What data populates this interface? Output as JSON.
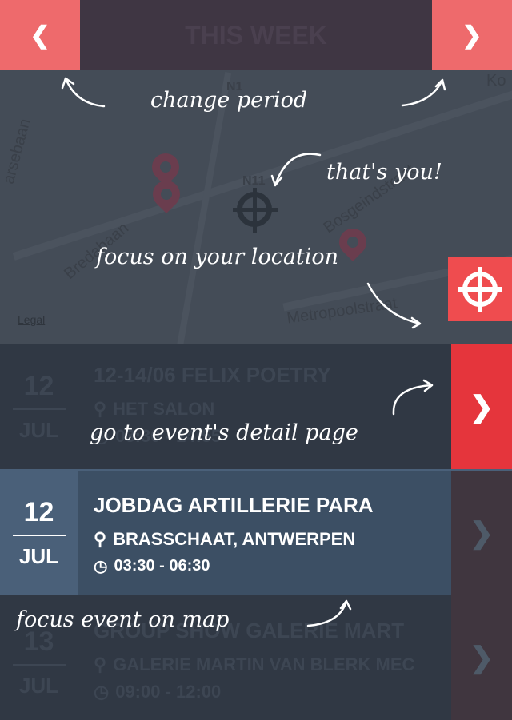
{
  "header": {
    "title": "THIS WEEK",
    "prev_icon": "chevron-left",
    "next_icon": "chevron-right"
  },
  "map": {
    "labels": [
      "N1",
      "N11",
      "Bredabaan",
      "Bosgeindstraat",
      "Metropoolstraat",
      "arsebaan",
      "Ko"
    ],
    "legal": "Legal",
    "locate_icon": "crosshair"
  },
  "events": [
    {
      "day": "12",
      "month": "JUL",
      "name": "12-14/06 FELIX POETRY",
      "location": "HET SALON",
      "time": "03:30 - 14:55"
    },
    {
      "day": "12",
      "month": "JUL",
      "name": "JOBDAG ARTILLERIE PARA",
      "location": "BRASSCHAAT, ANTWERPEN",
      "time": "03:30 - 06:30"
    },
    {
      "day": "13",
      "month": "JUL",
      "name": "GROUP SHOW GALERIE MART",
      "location": "GALERIE MARTIN VAN BLERK MEC",
      "time": "09:00 - 12:00"
    }
  ],
  "annotations": {
    "change_period": "change period",
    "thats_you": "that's you!",
    "focus_location": "focus on your location",
    "detail_page": "go to event's detail page",
    "focus_event": "focus event on map"
  },
  "colors": {
    "accent": "#ee6a6c",
    "red": "#e5353c",
    "header": "#3f3643",
    "active_row": "#3c4f64"
  }
}
